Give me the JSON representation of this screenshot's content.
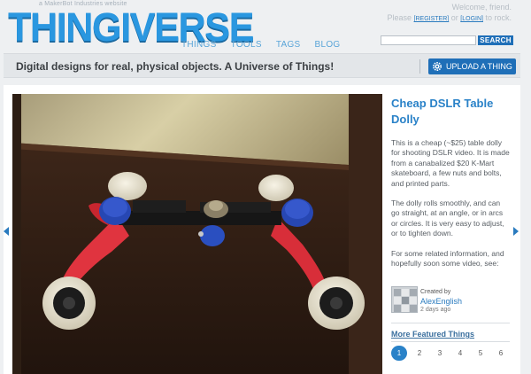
{
  "header": {
    "byline": "a MakerBot Industries website",
    "logo": "THINGIVERSE",
    "nav": [
      "THINGS",
      "TOOLS",
      "TAGS",
      "BLOG"
    ],
    "welcome": "Welcome, friend.",
    "please": "Please",
    "register": "[REGISTER]",
    "or": "or",
    "login": "[LOGIN]",
    "to_rock": "to rock.",
    "search_placeholder": "",
    "search_button": "SEARCH"
  },
  "tagbar": {
    "tagline": "Digital designs for real, physical objects. A Universe of Things!",
    "upload_button": "UPLOAD A THING"
  },
  "featured": {
    "title": "Cheap DSLR Table Dolly",
    "paragraphs": [
      "This is a cheap (~$25) table dolly for shooting DSLR video. It is made from a canabalized $20 K-Mart skateboard, a few nuts and bolts, and printed parts.",
      "The dolly rolls smoothly, and can go straight, at an angle, or in arcs or circles. It is very easy to adjust, or to tighten down.",
      "For some related information, and hopefully soon some video, see:"
    ],
    "created_by_label": "Created by",
    "creator": "AlexEnglish",
    "time": "2 days ago"
  },
  "more": {
    "title": "More Featured Things",
    "pages": [
      "1",
      "2",
      "3",
      "4",
      "5",
      "6"
    ],
    "active_page": "1"
  },
  "colors": {
    "brand_blue": "#2a97e0",
    "button_blue": "#1f6fb8",
    "link_blue": "#2a7bbf"
  }
}
